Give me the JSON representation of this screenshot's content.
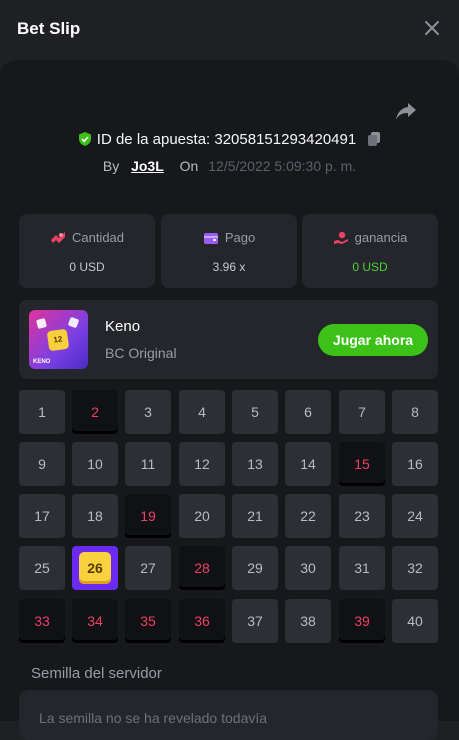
{
  "header": {
    "title": "Bet Slip",
    "close_icon": "close-icon"
  },
  "bet": {
    "id_label": "ID de la apuesta: 32058151293420491",
    "by_label": "By",
    "user": "Jo3L",
    "on_label": "On",
    "date": "12/5/2022 5:09:30 p. m."
  },
  "stats": [
    {
      "label": "Cantidad",
      "value": "0 USD",
      "icon": "bet-amount-icon",
      "icon_color": "#ed4163"
    },
    {
      "label": "Pago",
      "value": "3.96 x",
      "icon": "wallet-icon",
      "icon_color": "#9b5cf6"
    },
    {
      "label": "ganancia",
      "value": "0 USD",
      "icon": "profit-icon",
      "icon_color": "#ed4163"
    }
  ],
  "game": {
    "name": "Keno",
    "subtitle": "BC Original",
    "play_label": "Jugar ahora",
    "thumb_die": "12",
    "thumb_label": "KENO"
  },
  "grid": {
    "numbers": [
      "1",
      "2",
      "3",
      "4",
      "5",
      "6",
      "7",
      "8",
      "9",
      "10",
      "11",
      "12",
      "13",
      "14",
      "15",
      "16",
      "17",
      "18",
      "19",
      "20",
      "21",
      "22",
      "23",
      "24",
      "25",
      "26",
      "27",
      "28",
      "29",
      "30",
      "31",
      "32",
      "33",
      "34",
      "35",
      "36",
      "37",
      "38",
      "39",
      "40"
    ],
    "picked": [
      2,
      15,
      19,
      28,
      33,
      34,
      35,
      36,
      39
    ],
    "hit": [
      26
    ]
  },
  "seed": {
    "label": "Semilla del servidor",
    "text": "La semilla no se ha revelado todavía"
  },
  "colors": {
    "accent_green": "#3bc117",
    "profit_green": "#4cd137",
    "picked_red": "#ed4163",
    "hit_purple": "#6a2af1",
    "hit_yellow": "#f9d13c"
  }
}
